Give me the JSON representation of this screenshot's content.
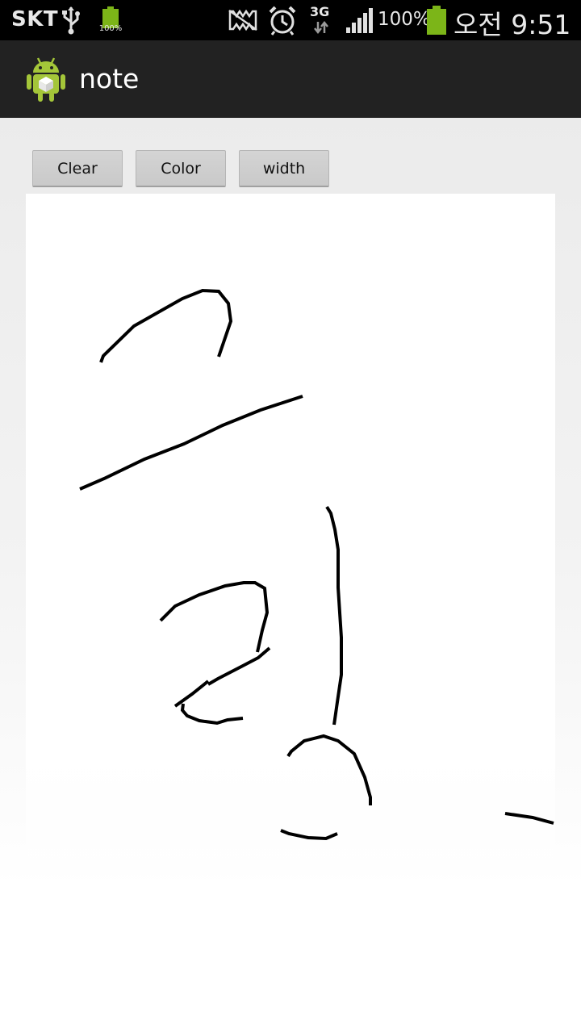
{
  "status_bar": {
    "carrier": "SKT",
    "notification_battery_label": "100%",
    "network_type": "3G",
    "battery_percent": "100%",
    "time": "오전 9:51",
    "icons": [
      "usb-icon",
      "battery-notification-icon",
      "no-sim-icon",
      "alarm-icon",
      "network-type-icon",
      "signal-icon",
      "battery-icon"
    ]
  },
  "action_bar": {
    "title": "note",
    "icon": "android-app-icon"
  },
  "toolbar": {
    "clear_label": "Clear",
    "color_label": "Color",
    "width_label": "width"
  },
  "canvas": {
    "stroke_color": "#000000",
    "background_color": "#ffffff"
  },
  "colors": {
    "status_bar_bg": "#000000",
    "action_bar_bg": "#222222",
    "android_green": "#a4c639",
    "battery_green": "#7cb518"
  }
}
